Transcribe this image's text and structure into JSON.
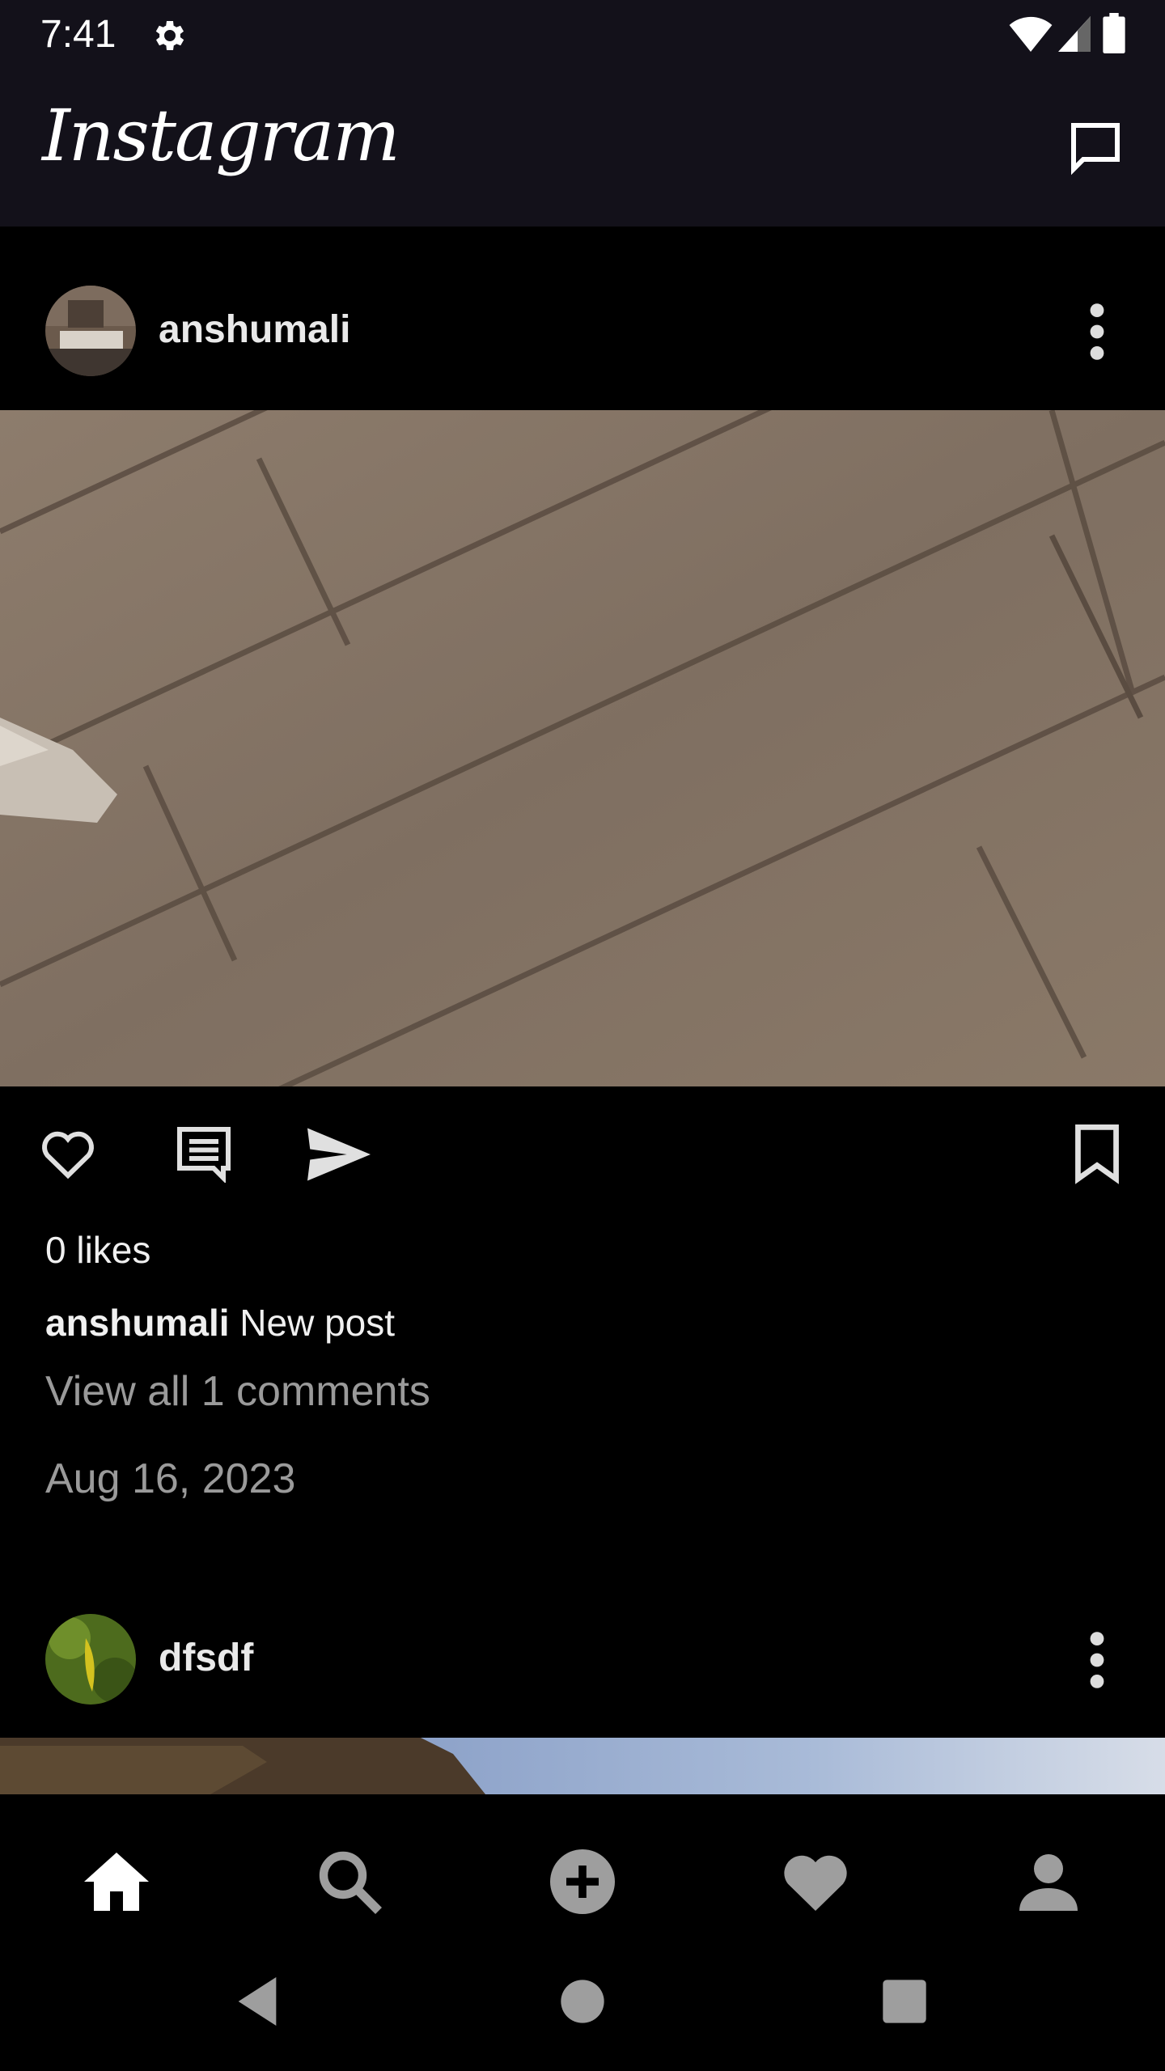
{
  "status_bar": {
    "time": "7:41",
    "icons": [
      "settings-icon",
      "wifi-icon",
      "cellular-signal-icon",
      "battery-icon"
    ]
  },
  "app_bar": {
    "title": "Instagram",
    "right_icon": "direct-message-icon"
  },
  "feed": {
    "posts": [
      {
        "username": "anshumali",
        "likes": "0 likes",
        "caption_user": "anshumali",
        "caption_text": "New post",
        "view_comments": "View all 1 comments",
        "date": "Aug 16, 2023",
        "actions": [
          "like-icon",
          "comment-icon",
          "share-icon",
          "bookmark-icon"
        ]
      },
      {
        "username": "dfsdf"
      }
    ]
  },
  "bottom_nav": {
    "items": [
      "home-icon",
      "search-icon",
      "add-post-icon",
      "activity-icon",
      "profile-icon"
    ],
    "active": "home-icon"
  },
  "system_nav": [
    "back-icon",
    "home-circle-icon",
    "recents-icon"
  ],
  "colors": {
    "app_bar_bg": "#13111a",
    "feed_bg": "#000000",
    "secondary_text": "#9a9a9a"
  }
}
